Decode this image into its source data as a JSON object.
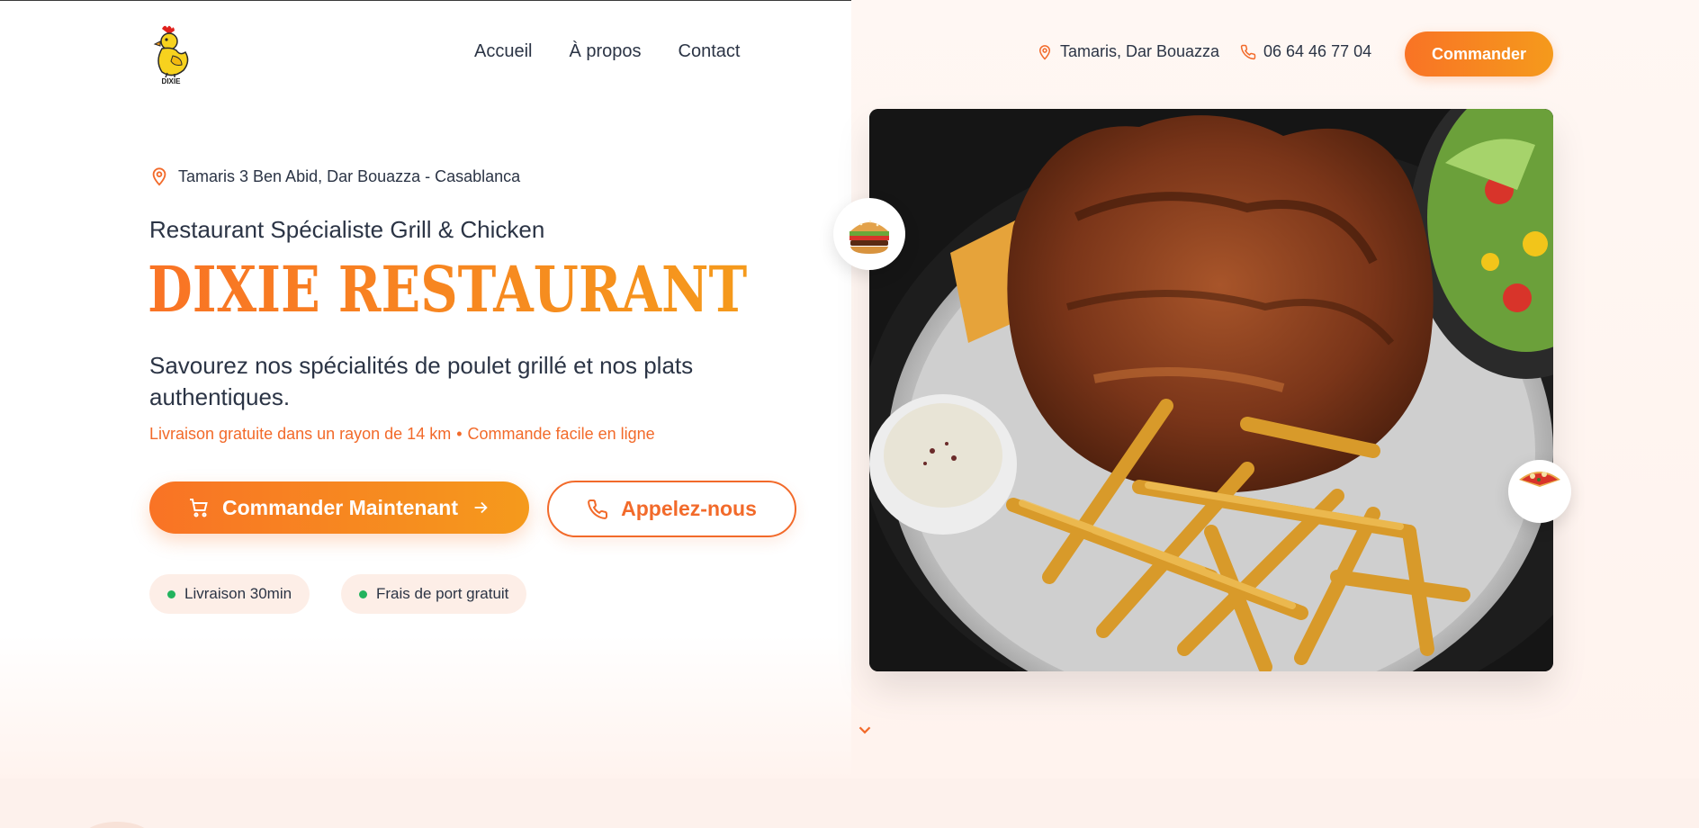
{
  "brand": {
    "name": "DIXIE",
    "logo_text": "DIXIE"
  },
  "nav": {
    "items": [
      "Accueil",
      "À propos",
      "Contact"
    ]
  },
  "header": {
    "location": "Tamaris, Dar Bouazza",
    "phone": "06 64 46 77 04",
    "order_label": "Commander"
  },
  "hero": {
    "address": "Tamaris 3 Ben Abid, Dar Bouazza - Casablanca",
    "tagline": "Restaurant Spécialiste Grill & Chicken",
    "title": "DIXIE RESTAURANT",
    "description": "Savourez nos spécialités de poulet grillé et nos plats authentiques.",
    "perk_1": "Livraison gratuite dans un rayon de 14 km",
    "perk_separator": "•",
    "perk_2": "Commande facile en ligne",
    "cta_primary": "Commander Maintenant",
    "cta_secondary": "Appelez-nous",
    "badges": [
      "Livraison 30min",
      "Frais de port gratuit"
    ]
  },
  "colors": {
    "accent": "#f97325",
    "accent_end": "#f59a1c",
    "success": "#22b35e",
    "text": "#2b3445"
  },
  "icons": [
    "location-pin-icon",
    "phone-icon",
    "cart-icon",
    "arrow-right-icon",
    "burger-icon",
    "pizza-icon",
    "chevron-down-icon"
  ]
}
